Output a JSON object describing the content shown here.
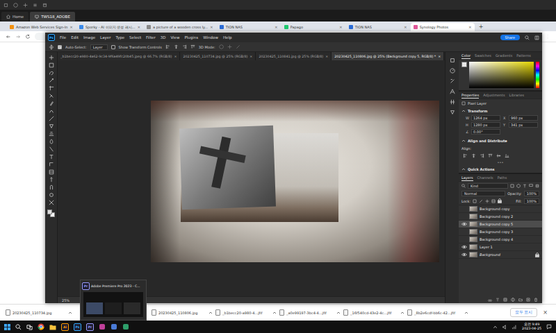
{
  "remote": {
    "tabs": [
      {
        "label": "Home",
        "selected": false
      },
      {
        "label": "TWS18_ADOBE",
        "selected": true
      }
    ]
  },
  "browser": {
    "tabs": [
      {
        "label": "Amazon Web Services Sign-In",
        "selected": false,
        "color": "#f29111"
      },
      {
        "label": "Sporky - AI 이미지 생성 레시...",
        "selected": false,
        "color": "#3b8beb"
      },
      {
        "label": "a picture of a wooden cross ly...",
        "selected": false,
        "color": "#8a8a8a"
      },
      {
        "label": "TION NAS",
        "selected": false,
        "color": "#2b6cd6"
      },
      {
        "label": "Papago",
        "selected": false,
        "color": "#1fc96f"
      },
      {
        "label": "TION NAS",
        "selected": false,
        "color": "#2b6cd6"
      },
      {
        "label": "Synology Photos",
        "selected": true,
        "color": "#e0579a"
      }
    ],
    "close": "×",
    "new_tab": "+"
  },
  "photoshop": {
    "logo": "Ps",
    "menu": [
      "File",
      "Edit",
      "Image",
      "Layer",
      "Type",
      "Select",
      "Filter",
      "3D",
      "View",
      "Plugins",
      "Window",
      "Help"
    ],
    "share": "Share",
    "options": {
      "auto_select": "Auto-Select:",
      "auto_select_checked": true,
      "target": "Layer",
      "show_transform": "Show Transform Controls",
      "show_transform_checked": false,
      "mode": "3D Mode:"
    },
    "documents": [
      {
        "label": "_b1becc20-a980-4a62-9c34-9f6a49fc20b45.jpeg @ 66.7% (RGB/8)",
        "selected": false
      },
      {
        "label": "20230425_110734.jpg @ 25% (RGB/8)",
        "selected": false
      },
      {
        "label": "20230425_110841.jpg @ 25% (RGB/8)",
        "selected": false
      },
      {
        "label": "20230425_110806.jpg @ 25% (Background copy 5, RGB/8) *",
        "selected": true
      }
    ],
    "doc_close": "×",
    "zoom": "25%",
    "color_tabs": [
      {
        "label": "Color",
        "selected": true
      },
      {
        "label": "Swatches",
        "selected": false
      },
      {
        "label": "Gradients",
        "selected": false
      },
      {
        "label": "Patterns",
        "selected": false
      }
    ],
    "properties_tabs": [
      {
        "label": "Properties",
        "selected": true
      },
      {
        "label": "Adjustments",
        "selected": false
      },
      {
        "label": "Libraries",
        "selected": false
      }
    ],
    "properties": {
      "kind": "Pixel Layer",
      "transform_title": "Transform",
      "fields": [
        {
          "label": "W",
          "value": "1264 px"
        },
        {
          "label": "X",
          "value": "960 px"
        },
        {
          "label": "H",
          "value": "1280 px"
        },
        {
          "label": "Y",
          "value": "341 px"
        },
        {
          "label": "∠",
          "value": "0.00°"
        }
      ],
      "align_title": "Align and Distribute",
      "align_label": "Align:",
      "more": "•••",
      "quick_actions": "Quick Actions"
    },
    "layers_tabs": [
      {
        "label": "Layers",
        "selected": true
      },
      {
        "label": "Channels",
        "selected": false
      },
      {
        "label": "Paths",
        "selected": false
      }
    ],
    "layers_filter": "Kind",
    "blend_mode": "Normal",
    "opacity_label": "Opacity:",
    "opacity": "100%",
    "lock_label": "Lock:",
    "fill_label": "Fill:",
    "fill": "100%",
    "layers": [
      {
        "name": "Background copy",
        "visible": false,
        "selected": false,
        "locked": false,
        "italic": false
      },
      {
        "name": "Background copy 2",
        "visible": false,
        "selected": false,
        "locked": false,
        "italic": false
      },
      {
        "name": "Background copy 5",
        "visible": true,
        "selected": true,
        "locked": false,
        "italic": false
      },
      {
        "name": "Background copy 3",
        "visible": false,
        "selected": false,
        "locked": false,
        "italic": false
      },
      {
        "name": "Background copy 4",
        "visible": false,
        "selected": false,
        "locked": false,
        "italic": false
      },
      {
        "name": "Layer 1",
        "visible": true,
        "selected": false,
        "locked": false,
        "italic": false
      },
      {
        "name": "Background",
        "visible": true,
        "selected": false,
        "locked": true,
        "italic": true
      }
    ]
  },
  "downloads": {
    "items": [
      "20230425_110734.jpg",
      "20230425_110806.jpg",
      "_b1becc20-a980-4...jfif",
      "_a0e99197-3bc4-4...jfif",
      "_16f540cd-43e2-4c...jfif",
      "_8b2e6cdf-bb6c-42...jfif"
    ],
    "show_all": "모두 표시",
    "close": "×"
  },
  "preview": {
    "title": "Adobe Premiere Pro 2023 - C...",
    "icon": "Pr"
  },
  "taskbar": {
    "apps": [
      {
        "label": "Ai",
        "color": "#ff9a00"
      },
      {
        "label": "Ps",
        "color": "#31a8ff"
      },
      {
        "label": "Pr",
        "color": "#9999ff"
      }
    ],
    "time": "오전 9:49",
    "date": "2023-04-25"
  }
}
